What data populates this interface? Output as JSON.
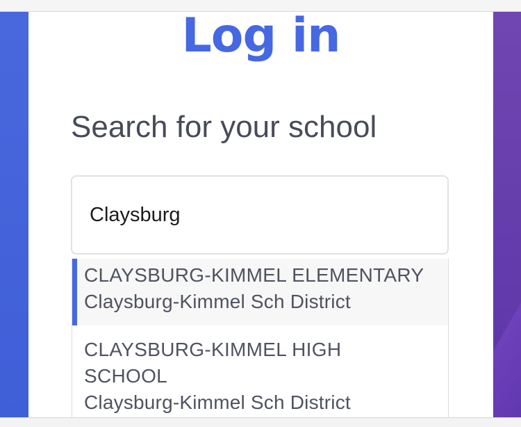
{
  "page": {
    "title": "Log in",
    "subtitle": "Search for your school"
  },
  "search": {
    "value": "Claysburg"
  },
  "results": [
    {
      "name": "CLAYSBURG-KIMMEL ELEMENTARY",
      "district": "Claysburg-Kimmel Sch District",
      "highlighted": true
    },
    {
      "name": "CLAYSBURG-KIMMEL HIGH SCHOOL",
      "district": "Claysburg-Kimmel Sch District",
      "highlighted": false
    }
  ],
  "colors": {
    "accent": "#4668e3",
    "text": "#474b59",
    "bg_left": "#4a68dd",
    "bg_right": "#6a41b0"
  }
}
